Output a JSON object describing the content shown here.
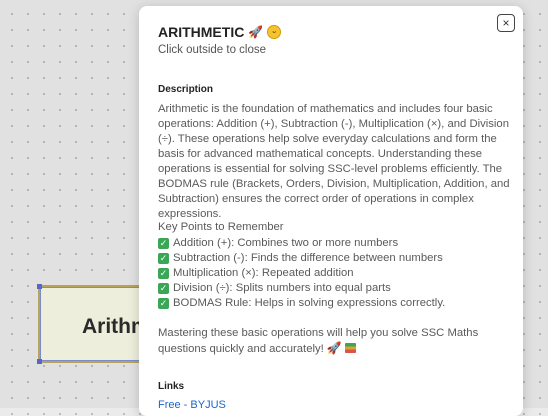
{
  "background": {
    "node_label": "Arithmetic"
  },
  "modal": {
    "title": "ARITHMETIC",
    "title_icons": [
      "rocket-icon",
      "smile-icon"
    ],
    "subtitle": "Click outside to close",
    "close_label": "×",
    "description_heading": "Description",
    "description": "Arithmetic is the foundation of mathematics and includes four basic operations: Addition (+), Subtraction (-), Multiplication (×), and Division (÷). These operations help solve everyday calculations and form the basis for advanced mathematical concepts. Understanding these operations is essential for solving SSC-level problems efficiently. The BODMAS rule (Brackets, Orders, Division, Multiplication, Addition, and Subtraction) ensures the correct order of operations in complex expressions.",
    "key_points_title": "Key Points to Remember",
    "key_points": [
      "Addition (+): Combines two or more numbers",
      "Subtraction (-): Finds the difference between numbers",
      "Multiplication (×): Repeated addition",
      "Division (÷): Splits numbers into equal parts",
      "BODMAS Rule: Helps in solving expressions correctly."
    ],
    "closing": "Mastering these basic operations will help you solve SSC Maths questions quickly and accurately!",
    "links_heading": "Links",
    "link_1": "Free - BYJUS"
  },
  "colors": {
    "check": "#3aa757",
    "link": "#1a66cc"
  }
}
